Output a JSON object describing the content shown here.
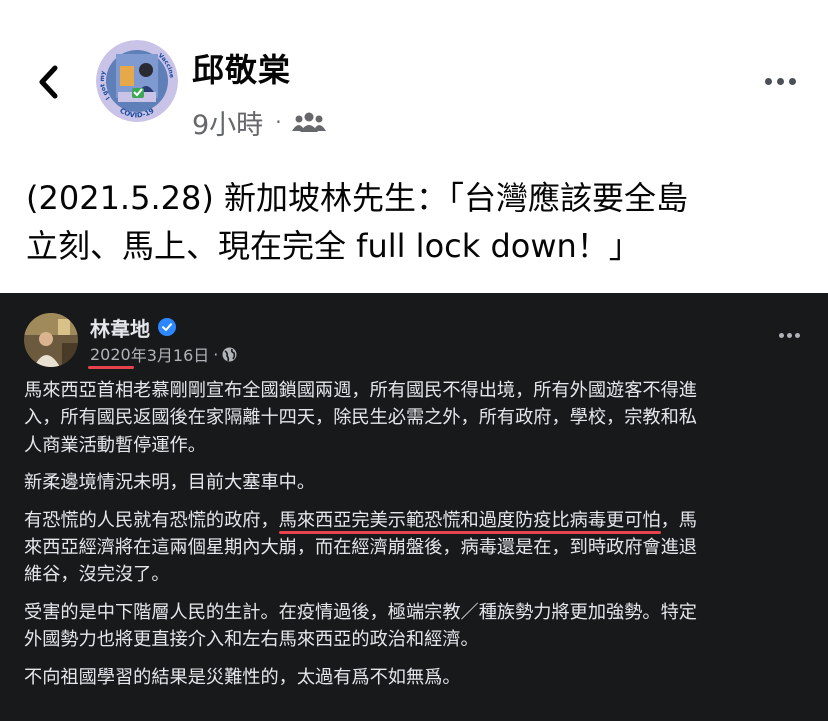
{
  "post": {
    "author": "邱敬棠",
    "time": "9小時",
    "audience_icon": "friends-icon",
    "caption_lines": [
      "(2021.5.28) 新加坡林先生：「台灣應該要全島",
      "立刻、馬上、現在完全 full lock down！」"
    ]
  },
  "embedded": {
    "author": "林韋地",
    "date_year": "2020",
    "date_rest": "年3月16日",
    "sep": "·",
    "para1": [
      "馬來西亞首相老慕剛剛宣布全國鎖國兩週，所有國民不得出境，所有外國遊客不得進",
      "入，所有國民返國後在家隔離十四天，除民生必需之外，所有政府，學校，宗教和私",
      "人商業活動暫停運作。"
    ],
    "para2": "新柔邊境情況未明，目前大塞車中。",
    "para3_line1_pre": "有恐慌的人民就有恐慌的政府，",
    "para3_line1_hl": "馬來西亞完美示範恐慌和過度防疫比病毒更可怕",
    "para3_line1_post": "，馬",
    "para3_rest": [
      "來西亞經濟將在這兩個星期內大崩，而在經濟崩盤後，病毒還是在，到時政府會進退",
      "維谷，沒完沒了。"
    ],
    "para4": [
      "受害的是中下階層人民的生計。在疫情過後，極端宗教／種族勢力將更加強勢。特定",
      "外國勢力也將更直接介入和左右馬來西亞的政治和經濟。"
    ],
    "para5": "不向祖國學習的結果是災難性的，太過有爲不如無爲。"
  },
  "avatar_text": {
    "left": "I got my",
    "bottom": "COVID-19",
    "right": "Vaccine"
  },
  "colors": {
    "accent_blue": "#1877f2",
    "underline_red": "#e8424e",
    "dark_bg": "#18191a"
  }
}
